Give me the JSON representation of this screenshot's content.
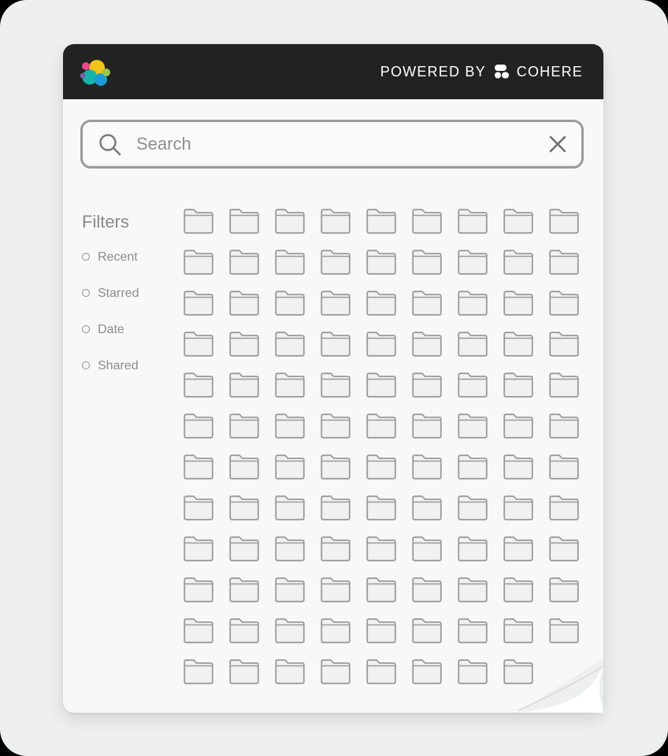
{
  "header": {
    "powered_by_label": "POWERED BY",
    "brand_label": "COHERE",
    "logo_icon": "elastic-logo-icon",
    "brand_icon": "cohere-mark-icon",
    "logo_colors": [
      "#f0c419",
      "#e8478b",
      "#13b5a8",
      "#1a9ad6",
      "#94c747"
    ]
  },
  "search": {
    "placeholder": "Search",
    "value": "",
    "search_icon": "search-icon",
    "clear_icon": "close-icon"
  },
  "filters": {
    "title": "Filters",
    "items": [
      {
        "label": "Recent",
        "selected": false
      },
      {
        "label": "Starred",
        "selected": false
      },
      {
        "label": "Date",
        "selected": false
      },
      {
        "label": "Shared",
        "selected": false
      }
    ]
  },
  "folders": {
    "icon": "folder-icon",
    "columns": 9,
    "rows": 12,
    "count": 107
  },
  "colors": {
    "header_bg": "#222222",
    "card_bg": "#f8f8f8",
    "page_bg": "#eef0f0",
    "folder_stroke": "#9a9a9a",
    "folder_fill": "#f1f1f1"
  }
}
